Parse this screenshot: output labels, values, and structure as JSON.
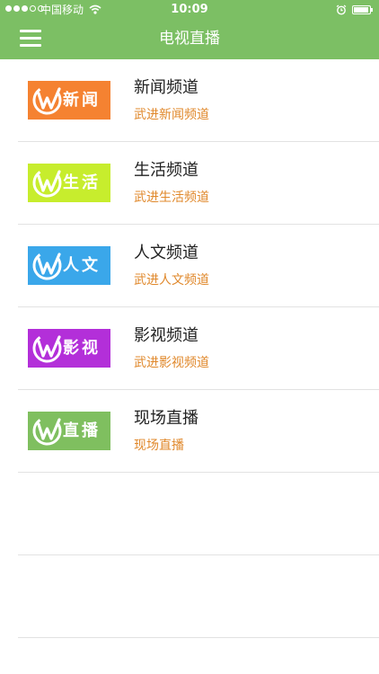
{
  "status_bar": {
    "carrier": "中国移动",
    "time": "10:09",
    "battery_level": 0.95
  },
  "nav": {
    "title": "电视直播",
    "menu_icon": "menu-icon"
  },
  "channels": [
    {
      "logo_text": "新闻",
      "logo_color": "#f58231",
      "title": "新闻频道",
      "subtitle": "武进新闻频道"
    },
    {
      "logo_text": "生活",
      "logo_color": "#c7ed2d",
      "title": "生活频道",
      "subtitle": "武进生活频道"
    },
    {
      "logo_text": "人文",
      "logo_color": "#3aa7ea",
      "title": "人文频道",
      "subtitle": "武进人文频道"
    },
    {
      "logo_text": "影视",
      "logo_color": "#b32fd9",
      "title": "影视频道",
      "subtitle": "武进影视频道"
    },
    {
      "logo_text": "直播",
      "logo_color": "#7fbf5f",
      "title": "现场直播",
      "subtitle": "现场直播"
    }
  ],
  "colors": {
    "header": "#7cbf64",
    "subtitle": "#e0882b",
    "divider": "#e2e2e2"
  }
}
